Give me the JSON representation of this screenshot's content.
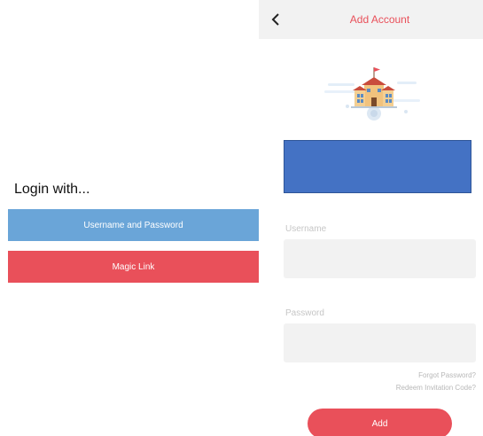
{
  "login_screen": {
    "heading": "Login with...",
    "username_password_button": "Username and Password",
    "magic_link_button": "Magic Link"
  },
  "add_account_screen": {
    "back_icon": "chevron-left-icon",
    "title": "Add Account",
    "illustration": "school-building-icon",
    "username_label": "Username",
    "username_value": "",
    "password_label": "Password",
    "password_value": "",
    "forgot_password_link": "Forgot Password?",
    "redeem_link": "Redeem Invitation Code?",
    "add_button": "Add"
  },
  "colors": {
    "accent_red": "#e9505a",
    "accent_blue": "#6aa5d8",
    "banner_blue": "#4472c4",
    "field_bg": "#f2f2f2"
  }
}
